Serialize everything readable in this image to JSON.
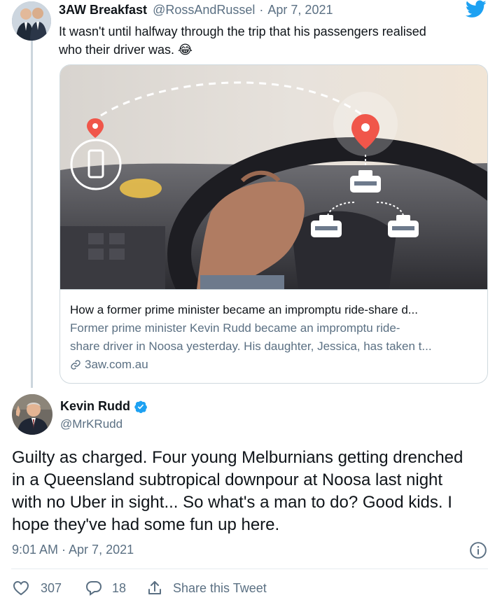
{
  "reply_tweet": {
    "author_name": "3AW Breakfast",
    "handle": "@RossAndRussel",
    "separator": "·",
    "date": "Apr 7, 2021",
    "text_line1": "It wasn't until halfway through the trip that his passengers realised",
    "text_line2": "who their driver was. 😂",
    "card": {
      "title": "How a former prime minister became an impromptu ride-share d...",
      "description_line1": "Former prime minister Kevin Rudd became an impromptu ride-",
      "description_line2": "share driver in Noosa yesterday. His daughter, Jessica, has taken t...",
      "domain": "3aw.com.au"
    }
  },
  "main_tweet": {
    "author_name": "Kevin Rudd",
    "verified": true,
    "handle": "@MrKRudd",
    "text_lines": [
      "Guilty as charged. Four young Melburnians getting drenched",
      "in a Queensland subtropical downpour at Noosa last night",
      "with no Uber in sight... So what's a man to do? Good kids. I",
      "hope they've had some fun up here."
    ],
    "timestamp": "9:01 AM · Apr 7, 2021",
    "likes": "307",
    "replies": "18",
    "share_label": "Share this Tweet"
  },
  "icons": {
    "brand": "twitter-bird-icon",
    "verified": "verified-badge-icon",
    "info": "info-icon",
    "like": "heart-icon",
    "reply": "reply-bubble-icon",
    "share": "share-icon",
    "link": "link-icon"
  },
  "colors": {
    "twitter_blue": "#1da1f2",
    "muted_text": "#5b7083",
    "location_pin": "#f0564a"
  }
}
